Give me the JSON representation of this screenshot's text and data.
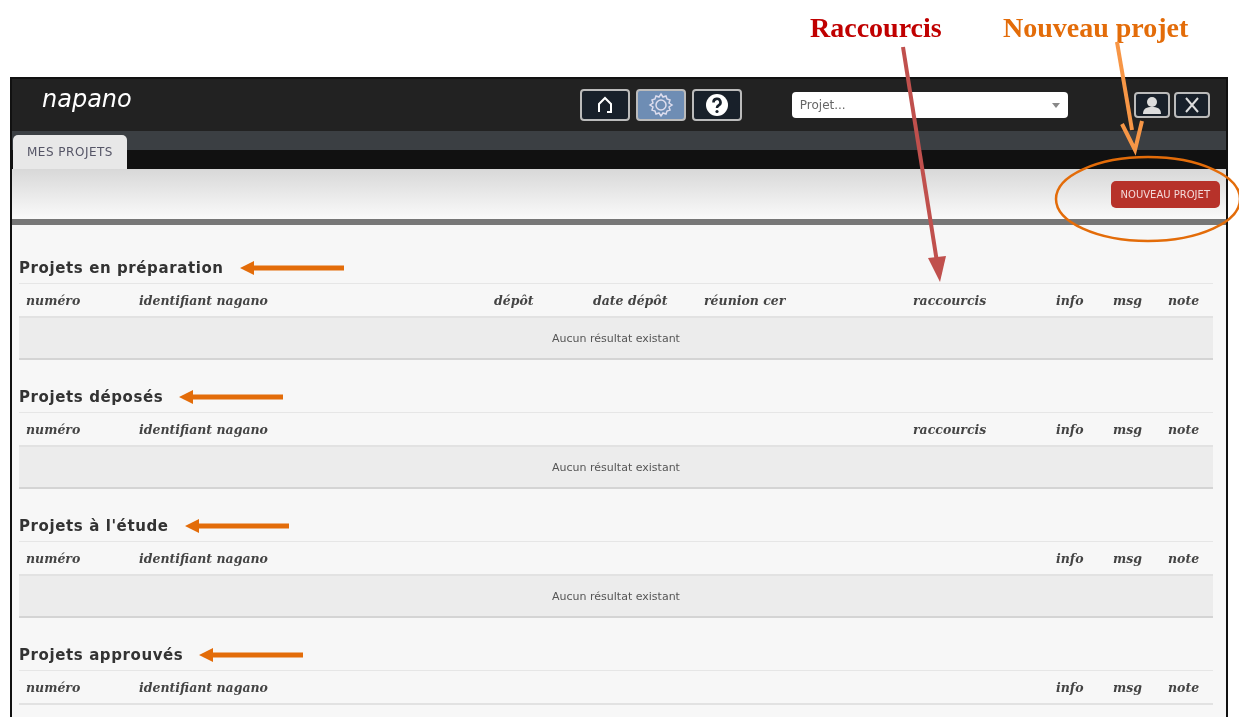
{
  "annotations": [
    {
      "text": "Raccourcis",
      "color": "#c00000"
    },
    {
      "text": "Nouveau projet",
      "color": "#e36c09"
    }
  ],
  "header": {
    "logo": "napano",
    "nav_buttons": [
      {
        "kind": "home",
        "selected": false
      },
      {
        "kind": "settings",
        "selected": true
      },
      {
        "kind": "help",
        "selected": false
      }
    ],
    "project_select": {
      "placeholder": "Projet..."
    }
  },
  "tabs": [
    {
      "label": "MES PROJETS",
      "selected": true
    }
  ],
  "toolbar": {
    "new_project_button": "NOUVEAU PROJET"
  },
  "sections": [
    {
      "title": "Projets en préparation",
      "columns": [
        {
          "label": "numéro",
          "kind": "number"
        },
        {
          "label": "identifiant nagano",
          "kind": "id"
        },
        {
          "label": "dépôt",
          "kind": "deposit"
        },
        {
          "label": "date dépôt",
          "kind": "date"
        },
        {
          "label": "réunion cer",
          "kind": "meeting"
        },
        {
          "label": "raccourcis",
          "kind": "shortcuts"
        },
        {
          "label": "info",
          "kind": "info"
        },
        {
          "label": "msg",
          "kind": "msg"
        },
        {
          "label": "note",
          "kind": "note"
        }
      ],
      "empty_message": "Aucun résultat existant"
    },
    {
      "title": "Projets déposés",
      "columns": [
        {
          "label": "numéro",
          "kind": "number"
        },
        {
          "label": "identifiant nagano",
          "kind": "id"
        },
        {
          "label": "raccourcis",
          "kind": "shortcuts"
        },
        {
          "label": "info",
          "kind": "info"
        },
        {
          "label": "msg",
          "kind": "msg"
        },
        {
          "label": "note",
          "kind": "note"
        }
      ],
      "empty_message": "Aucun résultat existant"
    },
    {
      "title": "Projets à l'étude",
      "columns": [
        {
          "label": "numéro",
          "kind": "number"
        },
        {
          "label": "identifiant nagano",
          "kind": "id"
        },
        {
          "label": "info",
          "kind": "info"
        },
        {
          "label": "msg",
          "kind": "msg"
        },
        {
          "label": "note",
          "kind": "note"
        }
      ],
      "empty_message": "Aucun résultat existant"
    },
    {
      "title": "Projets approuvés",
      "columns": [
        {
          "label": "numéro",
          "kind": "number"
        },
        {
          "label": "identifiant nagano",
          "kind": "id"
        },
        {
          "label": "info",
          "kind": "info"
        },
        {
          "label": "msg",
          "kind": "msg"
        },
        {
          "label": "note",
          "kind": "note"
        }
      ]
    }
  ]
}
